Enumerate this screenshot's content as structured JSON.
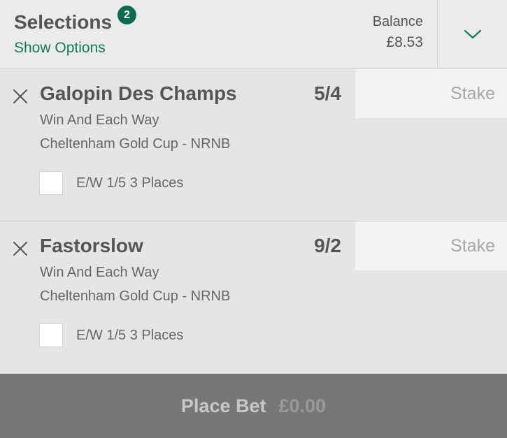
{
  "header": {
    "title": "Selections",
    "count_badge": "2",
    "show_options": "Show Options",
    "balance_label": "Balance",
    "balance_value": "£8.53",
    "expand_icon": "chevron-down-icon"
  },
  "bets": [
    {
      "horse": "Galopin Des Champs",
      "odds": "5/4",
      "stake_placeholder": "Stake",
      "market": "Win And Each Way",
      "event": "Cheltenham Gold Cup - NRNB",
      "ew_label": "E/W 1/5 3 Places",
      "ew_checked": false
    },
    {
      "horse": "Fastorslow",
      "odds": "9/2",
      "stake_placeholder": "Stake",
      "market": "Win And Each Way",
      "event": "Cheltenham Gold Cup - NRNB",
      "ew_label": "E/W 1/5 3 Places",
      "ew_checked": false
    }
  ],
  "footer": {
    "place_bet_label": "Place Bet",
    "place_bet_amount": "£0.00"
  },
  "colors": {
    "brand_green": "#0e6b51",
    "link_green": "#137a5a",
    "footer_bg": "#777777"
  }
}
